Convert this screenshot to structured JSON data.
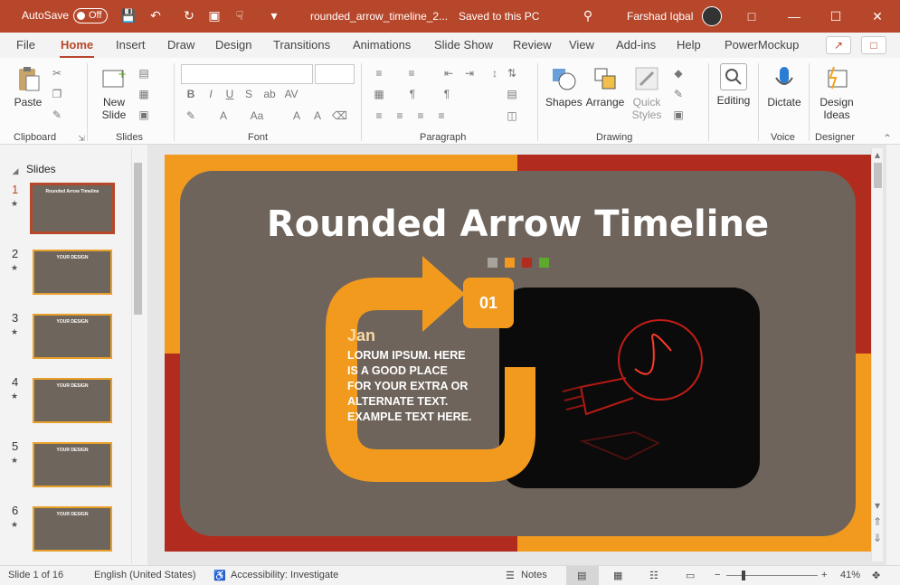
{
  "titlebar": {
    "autosave_label": "AutoSave",
    "autosave_state": "Off",
    "document_title": "rounded_arrow_timeline_2...",
    "save_status": "Saved to this PC",
    "user_name": "Farshad Iqbal",
    "accent_color": "#b7472a"
  },
  "tabs": [
    "File",
    "Home",
    "Insert",
    "Draw",
    "Design",
    "Transitions",
    "Animations",
    "Slide Show",
    "Review",
    "View",
    "Add-ins",
    "Help",
    "PowerMockup"
  ],
  "active_tab": "Home",
  "ribbon": {
    "groups": [
      "Clipboard",
      "Slides",
      "Font",
      "Paragraph",
      "Drawing",
      "Voice",
      "Designer"
    ],
    "paste": "Paste",
    "new_slide_1": "New",
    "new_slide_2": "Slide",
    "shapes": "Shapes",
    "arrange": "Arrange",
    "quick_styles_1": "Quick",
    "quick_styles_2": "Styles",
    "editing": "Editing",
    "dictate": "Dictate",
    "design_ideas_1": "Design",
    "design_ideas_2": "Ideas"
  },
  "slides_panel": {
    "header": "Slides",
    "thumbs": [
      {
        "num": "1",
        "title": "Rounded Arrow Timeline"
      },
      {
        "num": "2",
        "title": "YOUR DESIGN"
      },
      {
        "num": "3",
        "title": "YOUR DESIGN"
      },
      {
        "num": "4",
        "title": "YOUR DESIGN"
      },
      {
        "num": "5",
        "title": "YOUR DESIGN"
      },
      {
        "num": "6",
        "title": "YOUR DESIGN"
      }
    ]
  },
  "slide": {
    "title": "Rounded Arrow Timeline",
    "badge": "01",
    "month": "Jan",
    "body": "LORUM IPSUM. HERE IS A GOOD PLACE FOR YOUR EXTRA OR ALTERNATE TEXT. EXAMPLE TEXT HERE.",
    "dot_colors": [
      "#a8a39d",
      "#f29a1e",
      "#b12c1e",
      "#5ea82e"
    ]
  },
  "statusbar": {
    "slide_count": "Slide 1 of 16",
    "language": "English (United States)",
    "accessibility": "Accessibility: Investigate",
    "notes": "Notes",
    "zoom": "41%"
  }
}
